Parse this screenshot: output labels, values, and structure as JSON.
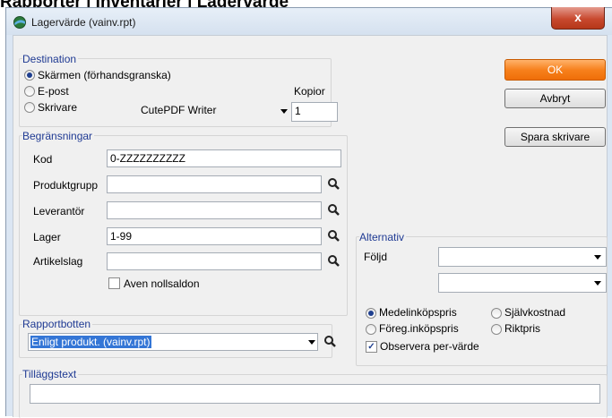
{
  "background_heading": "Rapporter | Inventarier | Lagervärde",
  "window": {
    "title": "Lagervärde (vainv.rpt)",
    "close_glyph": "x"
  },
  "destination": {
    "legend": "Destination",
    "options": [
      {
        "label": "Skärmen (förhandsgranska)",
        "selected": true
      },
      {
        "label": "E-post",
        "selected": false
      },
      {
        "label": "Skrivare",
        "selected": false
      }
    ],
    "printer": "CutePDF Writer",
    "copies_label": "Kopior",
    "copies_value": "1"
  },
  "buttons": {
    "ok": "OK",
    "cancel": "Avbryt",
    "save_printer": "Spara skrivare"
  },
  "limits": {
    "legend": "Begränsningar",
    "fields": [
      {
        "label": "Kod",
        "value": "0-ZZZZZZZZZZ",
        "lookup": false
      },
      {
        "label": "Produktgrupp",
        "value": "",
        "lookup": true
      },
      {
        "label": "Leverantör",
        "value": "",
        "lookup": true
      },
      {
        "label": "Lager",
        "value": "1-99",
        "lookup": true
      },
      {
        "label": "Artikelslag",
        "value": "",
        "lookup": true
      }
    ],
    "zero_balance_label": "Aven nollsaldon",
    "zero_balance_checked": false
  },
  "report_footer": {
    "legend": "Rapportbotten",
    "value": "Enligt produkt. (vainv.rpt)"
  },
  "alternatives": {
    "legend": "Alternativ",
    "order_label": "Följd",
    "order_value": "",
    "order_value2": "",
    "price_options": [
      {
        "label": "Medelinköpspris",
        "selected": true
      },
      {
        "label": "Självkostnad",
        "selected": false
      },
      {
        "label": "Föreg.inköpspris",
        "selected": false
      },
      {
        "label": "Riktpris",
        "selected": false
      }
    ],
    "observe_label": "Observera per-värde",
    "observe_checked": true
  },
  "extra_text": {
    "legend": "Tilläggstext",
    "value": ""
  },
  "colors": {
    "accent_ok": "#f7811d",
    "legend": "#1f3a93",
    "close": "#c8492f"
  }
}
